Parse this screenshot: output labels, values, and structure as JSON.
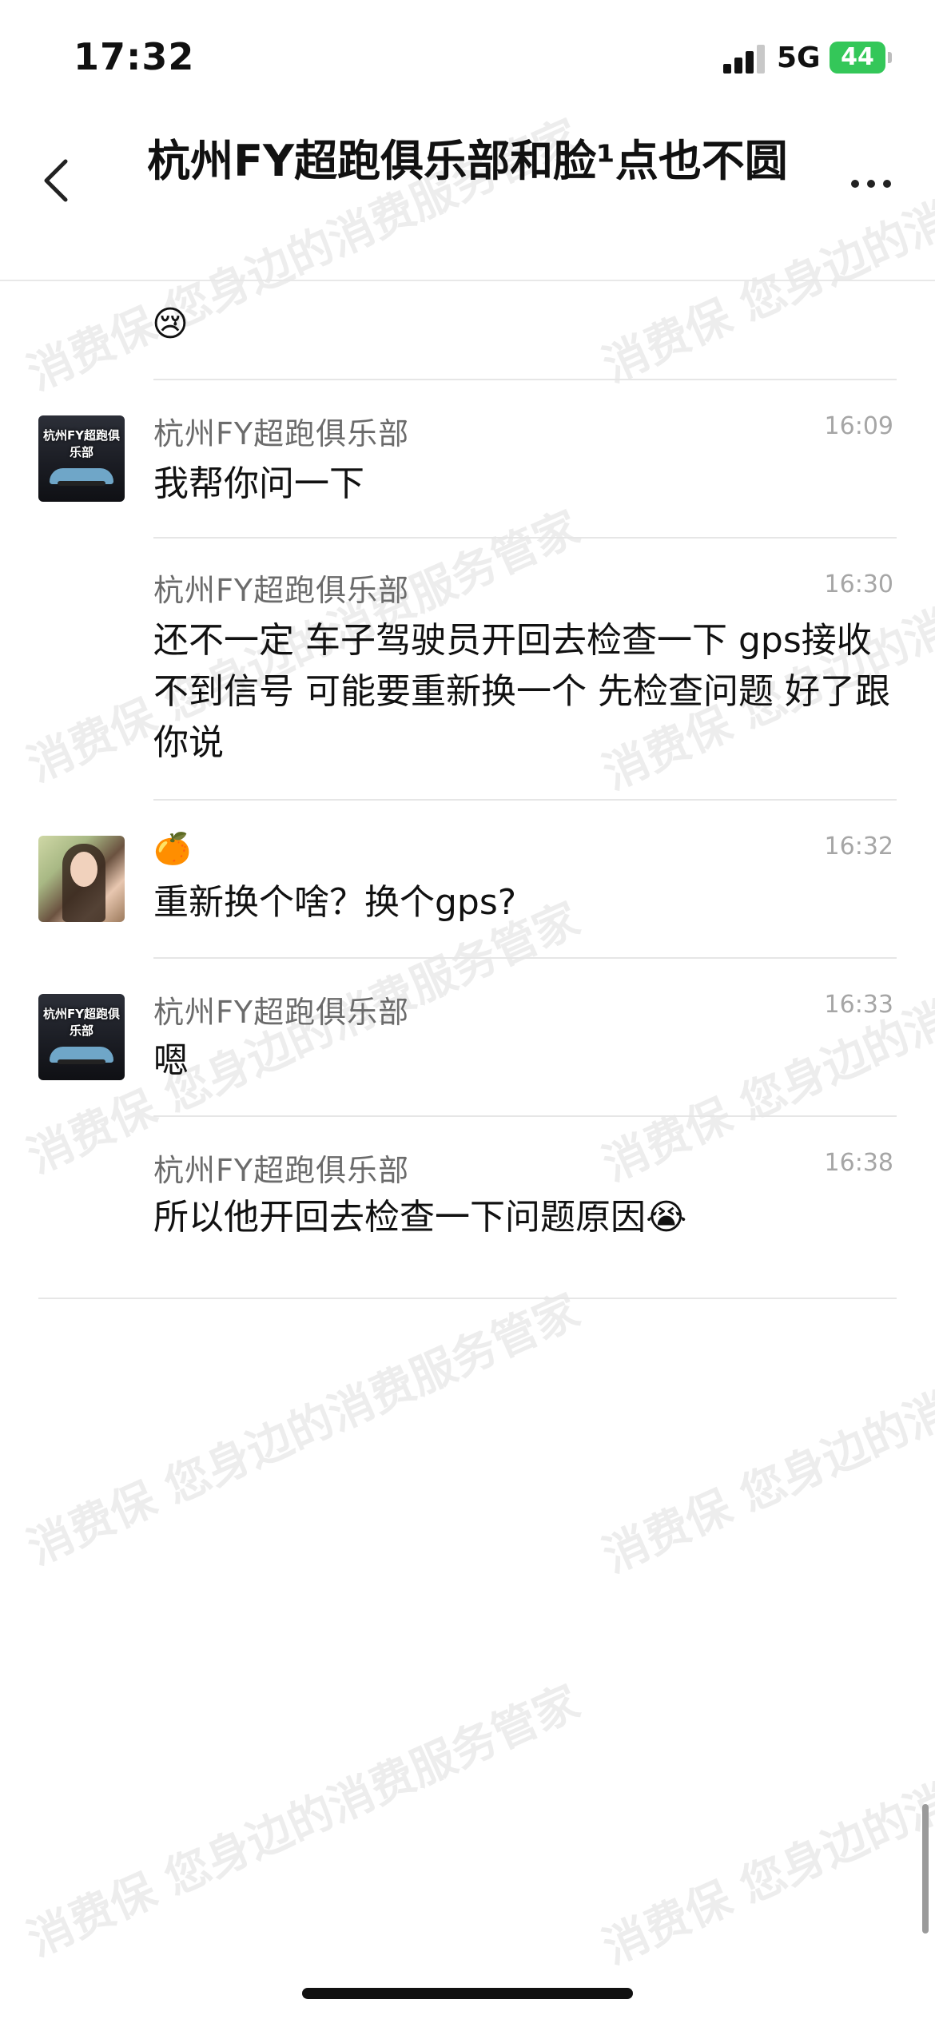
{
  "status_bar": {
    "time": "17:32",
    "network": "5G",
    "battery": "44"
  },
  "header": {
    "title": "杭州FY超跑俱乐部和脸¹点也不圆"
  },
  "watermark": {
    "text": "消费保 您身边的消费服务管家"
  },
  "messages": [
    {
      "sender": "",
      "time": "",
      "content": ""
    },
    {
      "sender": "杭州FY超跑俱乐部",
      "time": "16:09",
      "content": "我帮你问一下",
      "avatar": "club-logo"
    },
    {
      "sender": "杭州FY超跑俱乐部",
      "time": "16:30",
      "content": "还不一定 车子驾驶员开回去检查一下 gps接收不到信号 可能要重新换一个 先检查问题 好了跟你说"
    },
    {
      "sender": "🍊",
      "time": "16:32",
      "content": "重新换个啥？换个gps?",
      "avatar": "user-photo"
    },
    {
      "sender": "杭州FY超跑俱乐部",
      "time": "16:33",
      "content": "嗯",
      "avatar": "club-logo"
    },
    {
      "sender": "杭州FY超跑俱乐部",
      "time": "16:38",
      "content": "所以他开回去检查一下问题原因😭"
    }
  ],
  "first_message_partial_emoji": "😢",
  "avatar_club_text": "杭州FY超跑俱乐部"
}
